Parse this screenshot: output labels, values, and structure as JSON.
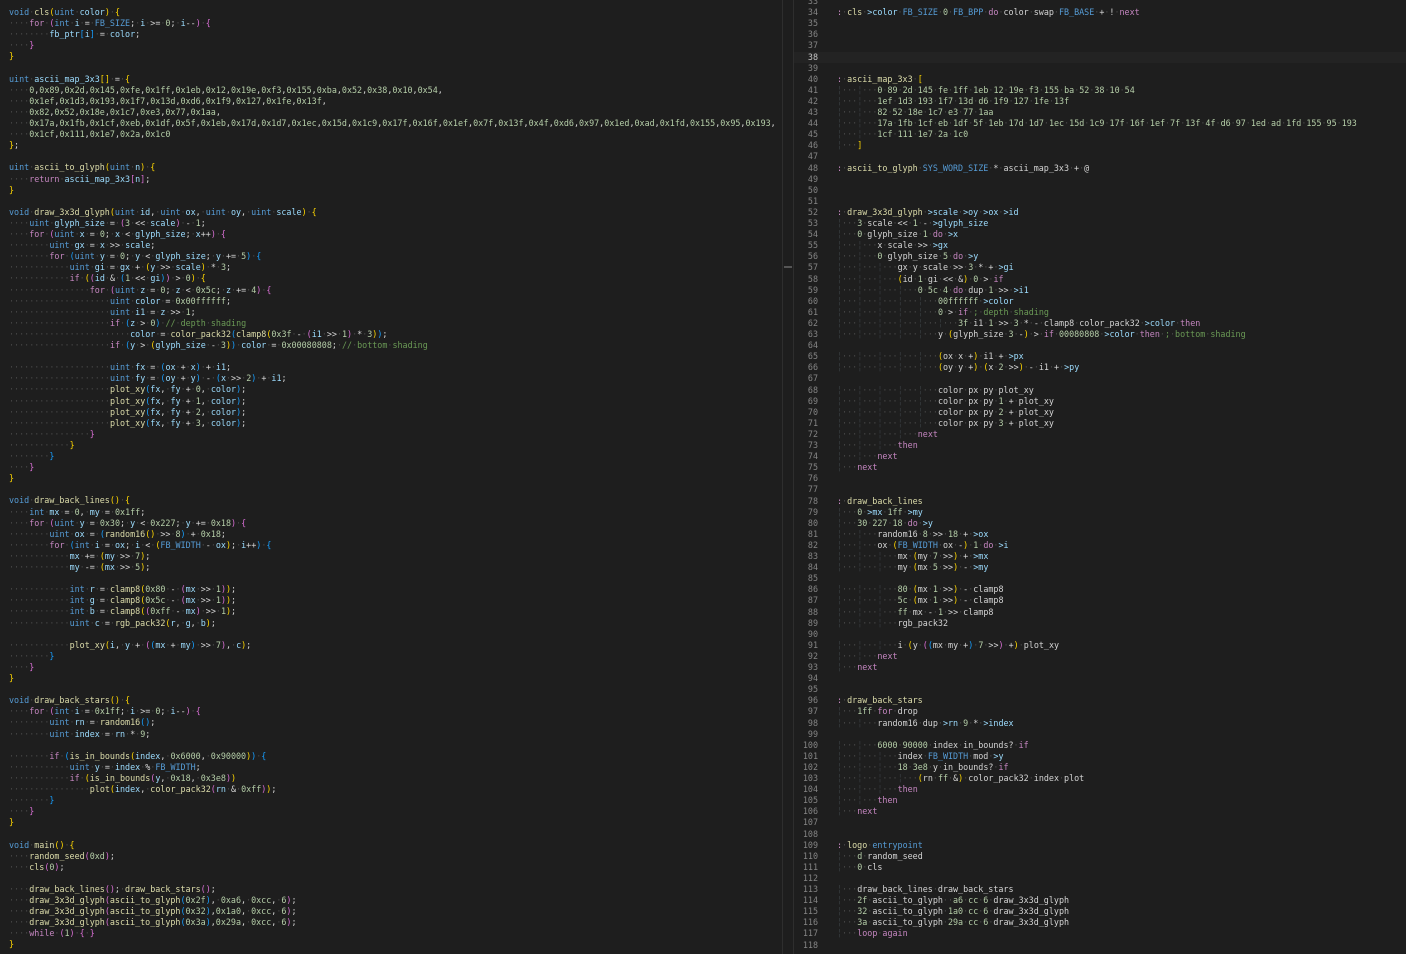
{
  "left_editor": {
    "language": "C",
    "lines": [
      "void cls(uint color) {",
      "    for (int i = FB_SIZE; i >= 0; i--) {",
      "        fb_ptr[i] = color;",
      "    }",
      "}",
      "",
      "uint ascii_map_3x3[] = {",
      "    0,0x89,0x2d,0x145,0xfe,0x1ff,0x1eb,0x12,0x19e,0xf3,0x155,0xba,0x52,0x38,0x10,0x54,",
      "    0x1ef,0x1d3,0x193,0x1f7,0x13d,0xd6,0x1f9,0x127,0x1fe,0x13f,",
      "    0x82,0x52,0x18e,0x1c7,0xe3,0x77,0x1aa,",
      "    0x17a,0x1fb,0x1cf,0xeb,0x1df,0x5f,0x1eb,0x17d,0x1d7,0x1ec,0x15d,0x1c9,0x17f,0x16f,0x1ef,0x7f,0x13f,0x4f,0xd6,0x97,0x1ed,0xad,0x1fd,0x155,0x95,0x193,",
      "    0x1cf,0x111,0x1e7,0x2a,0x1c0",
      "};",
      "",
      "uint ascii_to_glyph(uint n) {",
      "    return ascii_map_3x3[n];",
      "}",
      "",
      "void draw_3x3d_glyph(uint id, uint ox, uint oy, uint scale) {",
      "    uint glyph_size = (3 << scale) - 1;",
      "    for (uint x = 0; x < glyph_size; x++) {",
      "        uint gx = x >> scale;",
      "        for (uint y = 0; y < glyph_size; y += 5) {",
      "            uint gi = gx + (y >> scale) * 3;",
      "            if ((id & (1 << gi)) > 0) {",
      "                for (uint z = 0; z < 0x5c; z += 4) {",
      "                    uint color = 0x00ffffff;",
      "                    uint i1 = z >> 1;",
      "                    if (z > 0) // depth shading",
      "                        color = color_pack32(clamp8(0x3f - (i1 >> 1) * 3));",
      "                    if (y > (glyph_size - 3)) color = 0x00080808; // bottom shading",
      "",
      "                    uint fx = (ox + x) + i1;",
      "                    uint fy = (oy + y) - (x >> 2) + i1;",
      "                    plot_xy(fx, fy + 0, color);",
      "                    plot_xy(fx, fy + 1, color);",
      "                    plot_xy(fx, fy + 2, color);",
      "                    plot_xy(fx, fy + 3, color);",
      "                }",
      "            }",
      "        }",
      "    }",
      "}",
      "",
      "void draw_back_lines() {",
      "    int mx = 0, my = 0x1ff;",
      "    for (uint y = 0x30; y < 0x227; y += 0x18) {",
      "        uint ox = (random16() >> 8) + 0x18;",
      "        for (int i = ox; i < (FB_WIDTH - ox); i++) {",
      "            mx += (my >> 7);",
      "            my -= (mx >> 5);",
      "",
      "            int r = clamp8(0x80 - (mx >> 1));",
      "            int g = clamp8(0x5c - (mx >> 1));",
      "            int b = clamp8((0xff - mx) >> 1);",
      "            uint c = rgb_pack32(r, g, b);",
      "",
      "            plot_xy(i, y + ((mx + my) >> 7), c);",
      "        }",
      "    }",
      "}",
      "",
      "void draw_back_stars() {",
      "    for (int i = 0x1ff; i >= 0; i--) {",
      "        uint rn = random16();",
      "        uint index = rn * 9;",
      "",
      "        if (is_in_bounds(index, 0x6000, 0x90000)) {",
      "            uint y = index % FB_WIDTH;",
      "            if (is_in_bounds(y, 0x18, 0x3e8))",
      "                plot(index, color_pack32(rn & 0xff));",
      "        }",
      "    }",
      "}",
      "",
      "void main() {",
      "    random_seed(0xd);",
      "    cls(0);",
      "",
      "    draw_back_lines(); draw_back_stars();",
      "    draw_3x3d_glyph(ascii_to_glyph(0x2f), 0xa6, 0xcc, 6);",
      "    draw_3x3d_glyph(ascii_to_glyph(0x32),0x1a0, 0xcc, 6);",
      "    draw_3x3d_glyph(ascii_to_glyph(0x3a),0x29a, 0xcc, 6);",
      "    while (1) { }",
      "}"
    ]
  },
  "right_editor": {
    "language": "Forth",
    "first_visible_line": 33,
    "active_line": 38,
    "lines": [
      "",
      ": cls >color FB_SIZE 0 FB_BPP do color swap FB_BASE + ! next",
      "",
      "",
      "",
      "",
      "",
      ": ascii_map_3x3 [",
      "        0 89 2d 145 fe 1ff 1eb 12 19e f3 155 ba 52 38 10 54",
      "        1ef 1d3 193 1f7 13d d6 1f9 127 1fe 13f",
      "        82 52 18e 1c7 e3 77 1aa",
      "        17a 1fb 1cf eb 1df 5f 1eb 17d 1d7 1ec 15d 1c9 17f 16f 1ef 7f 13f 4f d6 97 1ed ad 1fd 155 95 193",
      "        1cf 111 1e7 2a 1c0",
      "    ]",
      "",
      ": ascii_to_glyph SYS_WORD_SIZE * ascii_map_3x3 + @",
      "",
      "",
      "",
      ": draw_3x3d_glyph >scale >oy >ox >id",
      "    3 scale << 1 - >glyph_size",
      "    0 glyph_size 1 do >x",
      "        x scale >> >gx",
      "        0 glyph_size 5 do >y",
      "            gx y scale >> 3 * + >gi",
      "            (id 1 gi << &) 0 > if",
      "                0 5c 4 do dup 1 >> >i1",
      "                    00ffffff >color",
      "                    0 > if ; depth shading",
      "                        3f i1 1 >> 3 * - clamp8 color_pack32 >color then",
      "                    y (glyph_size 3 -) > if 00080808 >color then ; bottom shading",
      "",
      "                    (ox x +) i1 + >px",
      "                    (oy y +) (x 2 >>) - i1 + >py",
      "",
      "                    color px py plot_xy",
      "                    color px py 1 + plot_xy",
      "                    color px py 2 + plot_xy",
      "                    color px py 3 + plot_xy",
      "                next",
      "            then",
      "        next",
      "    next",
      "",
      "",
      ": draw_back_lines",
      "    0 >mx 1ff >my",
      "    30 227 18 do >y",
      "        random16 8 >> 18 + >ox",
      "        ox (FB_WIDTH ox -) 1 do >i",
      "            mx (my 7 >>) + >mx",
      "            my (mx 5 >>) - >my",
      "",
      "            80 (mx 1 >>) - clamp8",
      "            5c (mx 1 >>) - clamp8",
      "            ff mx - 1 >> clamp8",
      "            rgb_pack32",
      "",
      "            i (y ((mx my +) 7 >>) +) plot_xy",
      "        next",
      "    next",
      "",
      "",
      ": draw_back_stars",
      "    1ff for drop",
      "        random16 dup >rn 9 * >index",
      "",
      "        6000 90000 index in_bounds? if",
      "            index FB_WIDTH mod >y",
      "            18 3e8 y in_bounds? if",
      "                (rn ff &) color_pack32 index plot",
      "            then",
      "        then",
      "    next",
      "",
      "",
      ": logo entrypoint",
      "    d random_seed",
      "    0 cls",
      "",
      "    draw_back_lines draw_back_stars",
      "    2f ascii_to_glyph  a6 cc 6 draw_3x3d_glyph",
      "    32 ascii_to_glyph 1a0 cc 6 draw_3x3d_glyph",
      "    3a ascii_to_glyph 29a cc 6 draw_3x3d_glyph",
      "    loop again",
      ""
    ]
  }
}
